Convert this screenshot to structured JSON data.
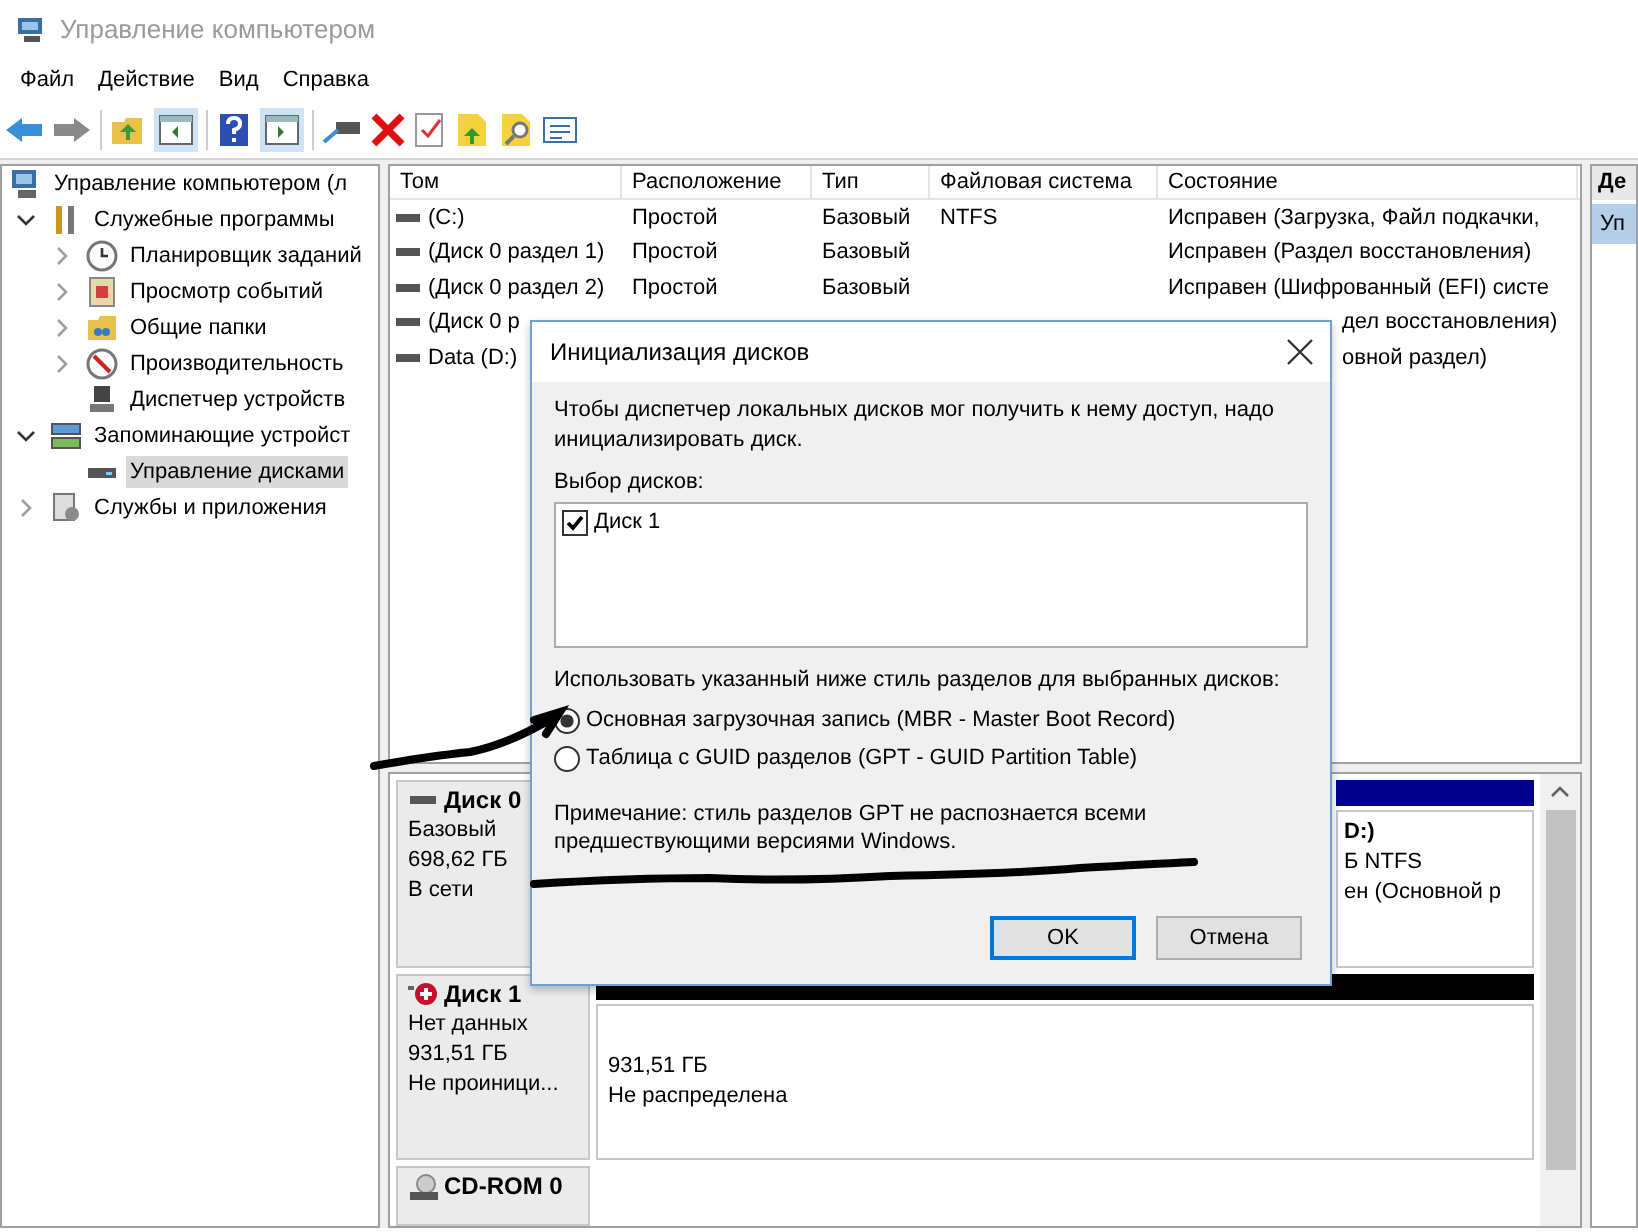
{
  "window": {
    "title": "Управление компьютером"
  },
  "menu": [
    "Файл",
    "Действие",
    "Вид",
    "Справка"
  ],
  "tree": [
    {
      "label": "Управление компьютером (л",
      "selected": false,
      "children": [
        {
          "label": "Служебные программы",
          "selected": false,
          "expanded": true,
          "children": [
            {
              "label": "Планировщик заданий",
              "selected": false,
              "expanded": false
            },
            {
              "label": "Просмотр событий",
              "selected": false,
              "expanded": false
            },
            {
              "label": "Общие папки",
              "selected": false,
              "expanded": false
            },
            {
              "label": "Производительность",
              "selected": false,
              "expanded": false
            },
            {
              "label": "Диспетчер устройств",
              "selected": false
            }
          ]
        },
        {
          "label": "Запоминающие устройст",
          "selected": false,
          "expanded": true,
          "children": [
            {
              "label": "Управление дисками",
              "selected": true
            }
          ]
        },
        {
          "label": "Службы и приложения",
          "selected": false,
          "expanded": false
        }
      ]
    }
  ],
  "table": {
    "columns": [
      "Том",
      "Расположение",
      "Тип",
      "Файловая система",
      "Состояние"
    ],
    "rows": [
      {
        "volume": "(C:)",
        "layout": "Простой",
        "type": "Базовый",
        "fs": "NTFS",
        "state": "Исправен (Загрузка, Файл подкачки,",
        "covered": false
      },
      {
        "volume": "(Диск 0 раздел 1)",
        "layout": "Простой",
        "type": "Базовый",
        "state": "Исправен (Раздел восстановления)",
        "covered": false
      },
      {
        "volume": "(Диск 0 раздел 2)",
        "layout": "Простой",
        "type": "Базовый",
        "state": "Исправен (Шифрованный (EFI) систе",
        "covered": false
      },
      {
        "volume": "(Диск 0 р",
        "state": "дел восстановления)",
        "covered": true
      },
      {
        "volume": "Data (D:)",
        "state": "овной раздел)",
        "covered": true
      }
    ]
  },
  "disks": [
    {
      "kind": "basic",
      "name": "Диск 0",
      "type": "Базовый",
      "size": "698,62 ГБ",
      "status": "В сети",
      "partition": {
        "kind": "primary",
        "lines": [
          "D:)",
          "Б NTFS",
          "ен (Основной р"
        ]
      }
    },
    {
      "kind": "unknown",
      "name": "Диск 1",
      "type": "Нет данных",
      "size": "931,51 ГБ",
      "status": "Не проиници...",
      "partition": {
        "kind": "unallocated",
        "lines": [
          "931,51 ГБ",
          "Не распределена"
        ]
      }
    },
    {
      "kind": "cdrom",
      "name": "CD-ROM 0"
    }
  ],
  "actions": {
    "header": "Де",
    "items": [
      {
        "label": "Уп",
        "selected": true
      }
    ]
  },
  "dialog": {
    "title": "Инициализация дисков",
    "message": "Чтобы диспетчер локальных дисков мог получить к нему доступ, надо инициализировать диск.",
    "list_label": "Выбор дисков:",
    "disks": [
      {
        "label": "Диск 1",
        "checked": true
      }
    ],
    "style_label": "Использовать указанный ниже стиль разделов для выбранных дисков:",
    "options": [
      {
        "label": "Основная загрузочная запись (MBR - Master Boot Record)",
        "selected": true
      },
      {
        "label": "Таблица с GUID разделов (GPT - GUID Partition Table)",
        "selected": false
      }
    ],
    "note": "Примечание: стиль разделов GPT не распознается всеми предшествующими версиями Windows.",
    "buttons": [
      {
        "label": "OK",
        "default": true
      },
      {
        "label": "Отмена",
        "default": false
      }
    ]
  }
}
